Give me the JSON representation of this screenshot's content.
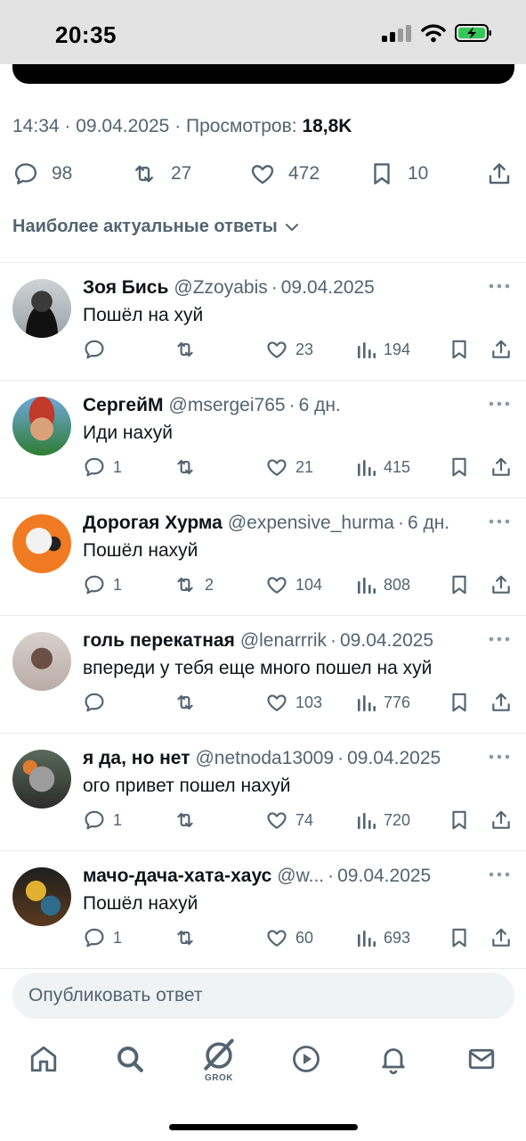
{
  "status_bar": {
    "time": "20:35"
  },
  "post": {
    "time": "14:34",
    "date": "09.04.2025",
    "views_label": "Просмотров:",
    "views": "18,8K",
    "replies": "98",
    "reposts": "27",
    "likes": "472",
    "bookmarks": "10"
  },
  "sort": {
    "label": "Наиболее актуальные ответы"
  },
  "replies": [
    {
      "name": "Зоя Бись",
      "handle": "@Zzoyabis",
      "date": "09.04.2025",
      "text": "Пошёл на хуй",
      "reply_count": "",
      "repost_count": "",
      "likes": "23",
      "views": "194"
    },
    {
      "name": "СергейМ",
      "handle": "@msergei765",
      "date": "6 дн.",
      "text": "Иди нахуй",
      "reply_count": "1",
      "repost_count": "",
      "likes": "21",
      "views": "415"
    },
    {
      "name": "Дорогая Хурма",
      "handle": "@expensive_hurma",
      "date": "6 дн.",
      "text": "Пошёл нахуй",
      "reply_count": "1",
      "repost_count": "2",
      "likes": "104",
      "views": "808"
    },
    {
      "name": "голь перекатная",
      "handle": "@lenarrrik",
      "date": "09.04.2025",
      "text": "впереди у тебя еще много пошел на хуй",
      "reply_count": "",
      "repost_count": "",
      "likes": "103",
      "views": "776"
    },
    {
      "name": "я да, но нет",
      "handle": "@netnoda13009",
      "date": "09.04.2025",
      "text": "ого привет пошел нахуй",
      "reply_count": "1",
      "repost_count": "",
      "likes": "74",
      "views": "720"
    },
    {
      "name": "мачо-дача-хата-хаус",
      "handle": "@w...",
      "date": "09.04.2025",
      "text": "Пошёл нахуй",
      "reply_count": "1",
      "repost_count": "",
      "likes": "60",
      "views": "693"
    }
  ],
  "compose": {
    "placeholder": "Опубликовать ответ"
  },
  "nav": {
    "grok_label": "GROK"
  },
  "colors": {
    "text_primary": "#0f1419",
    "text_secondary": "#536471",
    "divider": "#e6e9ec",
    "compose_bg": "#eff3f4",
    "battery_green": "#34c759"
  },
  "icons": {
    "reply": "speech-bubble-icon",
    "repost": "repost-arrows-icon",
    "like": "heart-icon",
    "views": "bar-chart-icon",
    "bookmark": "bookmark-icon",
    "share": "share-upload-icon",
    "more": "more-dots-icon",
    "sort": "chevron-down-icon"
  }
}
